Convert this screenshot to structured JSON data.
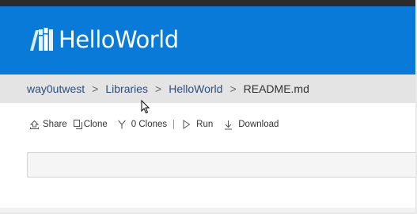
{
  "header": {
    "app_title": "HelloWorld",
    "brand_color": "#0a7ad8",
    "logo_icon": "books-icon"
  },
  "breadcrumb": {
    "items": [
      "way0utwest",
      "Libraries",
      "HelloWorld"
    ],
    "separator": ">",
    "current": "README.md"
  },
  "toolbar": {
    "share_label": "Share",
    "clone_label": "Clone",
    "clones_count_label": "0 Clones",
    "run_label": "Run",
    "download_label": "Download"
  },
  "search": {
    "placeholder": ""
  }
}
